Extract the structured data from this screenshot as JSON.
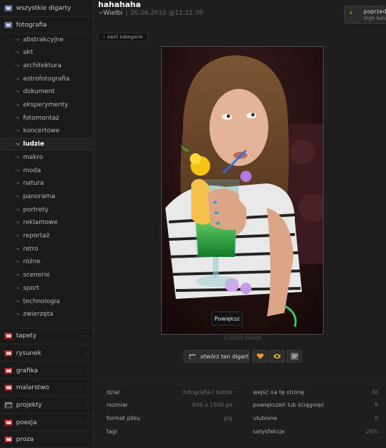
{
  "sidebar": {
    "top_categories": [
      {
        "label": "wszystkie digarty",
        "icon": "folder-icon"
      },
      {
        "label": "fotografia",
        "icon": "folder-icon"
      }
    ],
    "subcategories": [
      "abstrakcyjne",
      "akt",
      "architektura",
      "astrofotografia",
      "dokument",
      "eksperymenty",
      "fotomontaż",
      "koncertowe",
      "ludzie",
      "makro",
      "moda",
      "natura",
      "panorama",
      "portrety",
      "reklamowe",
      "reportaż",
      "retro",
      "różne",
      "scenerie",
      "sport",
      "technologia",
      "zwierzęta"
    ],
    "active_subcategory": "ludzie",
    "bottom_categories": [
      {
        "label": "tapety",
        "icon": "wallpaper-icon"
      },
      {
        "label": "rysunek",
        "icon": "drawing-icon"
      },
      {
        "label": "grafika",
        "icon": "graphics-icon"
      },
      {
        "label": "malarstwo",
        "icon": "painting-icon"
      },
      {
        "label": "projekty",
        "icon": "projects-icon"
      },
      {
        "label": "poezja",
        "icon": "poetry-icon"
      },
      {
        "label": "proza",
        "icon": "prose-icon"
      }
    ]
  },
  "header": {
    "title": "hahahaha",
    "author": "~Wielbi",
    "date": "26.06.2010 @11:21:30",
    "collapse_label": "zwiń kategorie",
    "prev_label": "poprzedni",
    "prev_sub": "tego autora"
  },
  "image": {
    "zoom_label": "Powiększ",
    "copyright": "©2010 Wielbi"
  },
  "actions": {
    "open_label": "otwórz ten digart"
  },
  "stats": {
    "left": [
      {
        "key": "dział",
        "value": "fotografia / ludzie"
      },
      {
        "key": "rozmiar",
        "value": "846 x 1500 px"
      },
      {
        "key": "format pliku",
        "value": "jpg"
      },
      {
        "key": "tagi",
        "value": ""
      }
    ],
    "right": [
      {
        "key": "wejść na tę stronę",
        "value": "30"
      },
      {
        "key": "powiększeń lub ściągnięć",
        "value": "6"
      },
      {
        "key": "ulubione",
        "value": "0"
      },
      {
        "key": "satysfakcja",
        "value": "26%"
      }
    ]
  },
  "colors": {
    "background": "#1e1e1e",
    "sidebar": "#1a1a1a",
    "accent": "#e0a020"
  }
}
